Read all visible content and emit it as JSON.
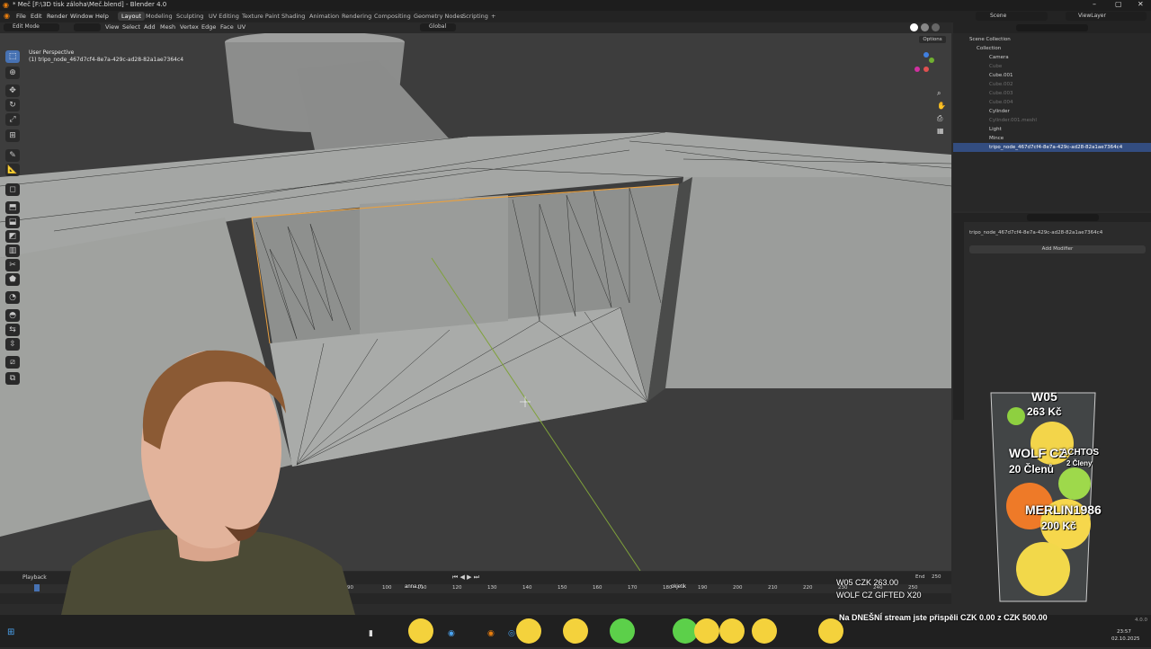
{
  "window": {
    "title": "* Meč [F:\\3D tisk záloha\\Meč.blend] - Blender 4.0",
    "minimize": "–",
    "maximize": "▢",
    "close": "✕"
  },
  "menus": [
    "File",
    "Edit",
    "Render",
    "Window",
    "Help"
  ],
  "workspaces": [
    "Layout",
    "Modeling",
    "Sculpting",
    "UV Editing",
    "Texture Paint",
    "Shading",
    "Animation",
    "Rendering",
    "Compositing",
    "Geometry Nodes",
    "Scripting"
  ],
  "active_workspace": "Layout",
  "scene": {
    "label": "Scene",
    "view_layer": "ViewLayer"
  },
  "viewport_header": {
    "mode": "Edit Mode",
    "menus": [
      "View",
      "Select",
      "Add",
      "Mesh",
      "Vertex",
      "Edge",
      "Face",
      "UV"
    ],
    "orientation": "Global",
    "options": "Options"
  },
  "viewport_overlay": {
    "perspective": "User Perspective",
    "object": "(1) tripo_node_467d7cf4-8e7a-429c-ad28-82a1ae7364c4"
  },
  "outliner": {
    "header": "Scene Collection",
    "items": [
      {
        "label": "Collection",
        "muted": false
      },
      {
        "label": "Camera",
        "muted": false
      },
      {
        "label": "Cube",
        "muted": true
      },
      {
        "label": "Cube.001",
        "muted": false
      },
      {
        "label": "Cube.002",
        "muted": true
      },
      {
        "label": "Cube.003",
        "muted": true
      },
      {
        "label": "Cube.004",
        "muted": true
      },
      {
        "label": "Cylinder",
        "muted": false
      },
      {
        "label": "Cylinder.001.meshl",
        "muted": true
      },
      {
        "label": "Light",
        "muted": false
      },
      {
        "label": "Mince",
        "muted": false
      },
      {
        "label": "tripo_node_467d7cf4-8e7a-429c-ad28-82a1ae7364c4",
        "muted": false,
        "selected": true
      }
    ]
  },
  "properties": {
    "object_name": "tripo_node_467d7cf4-8e7a-429c-ad28-82a1ae7364c4",
    "add_modifier": "Add Modifier"
  },
  "timeline": {
    "playback": "Playback",
    "end_label": "End",
    "end_value": "250",
    "ticks": [
      "90",
      "100",
      "110",
      "120",
      "130",
      "140",
      "150",
      "160",
      "170",
      "180",
      "190",
      "200",
      "210",
      "220",
      "230",
      "240",
      "250"
    ]
  },
  "donation_widget": {
    "line1": "W05",
    "line2": "263 Kč",
    "line3": "WOLF CZ",
    "line4": "20 Členů",
    "line5": "MERLIN1986",
    "line6": "200 Kč",
    "overlay_tag": "ACHTOS",
    "overlay_sub": "2 Členy"
  },
  "stream_alerts": {
    "alert1": "W05   CZK 263.00",
    "alert2": "WOLF CZ   GIFTED X20",
    "goal": "Na DNEŠNÍ stream jste přispěli CZK 0.00 z CZK 500.00",
    "name_tag1": "anna.m.",
    "name_tag2": "okjetik"
  },
  "taskbar": {
    "time": "23:57",
    "date": "02.10.2025",
    "version": "4.0.0"
  },
  "colors": {
    "accent": "#4772b3",
    "selection_orange": "#e8a040",
    "mesh_gray": "#a6a8a6",
    "floor_gray": "#3d3d3d"
  }
}
